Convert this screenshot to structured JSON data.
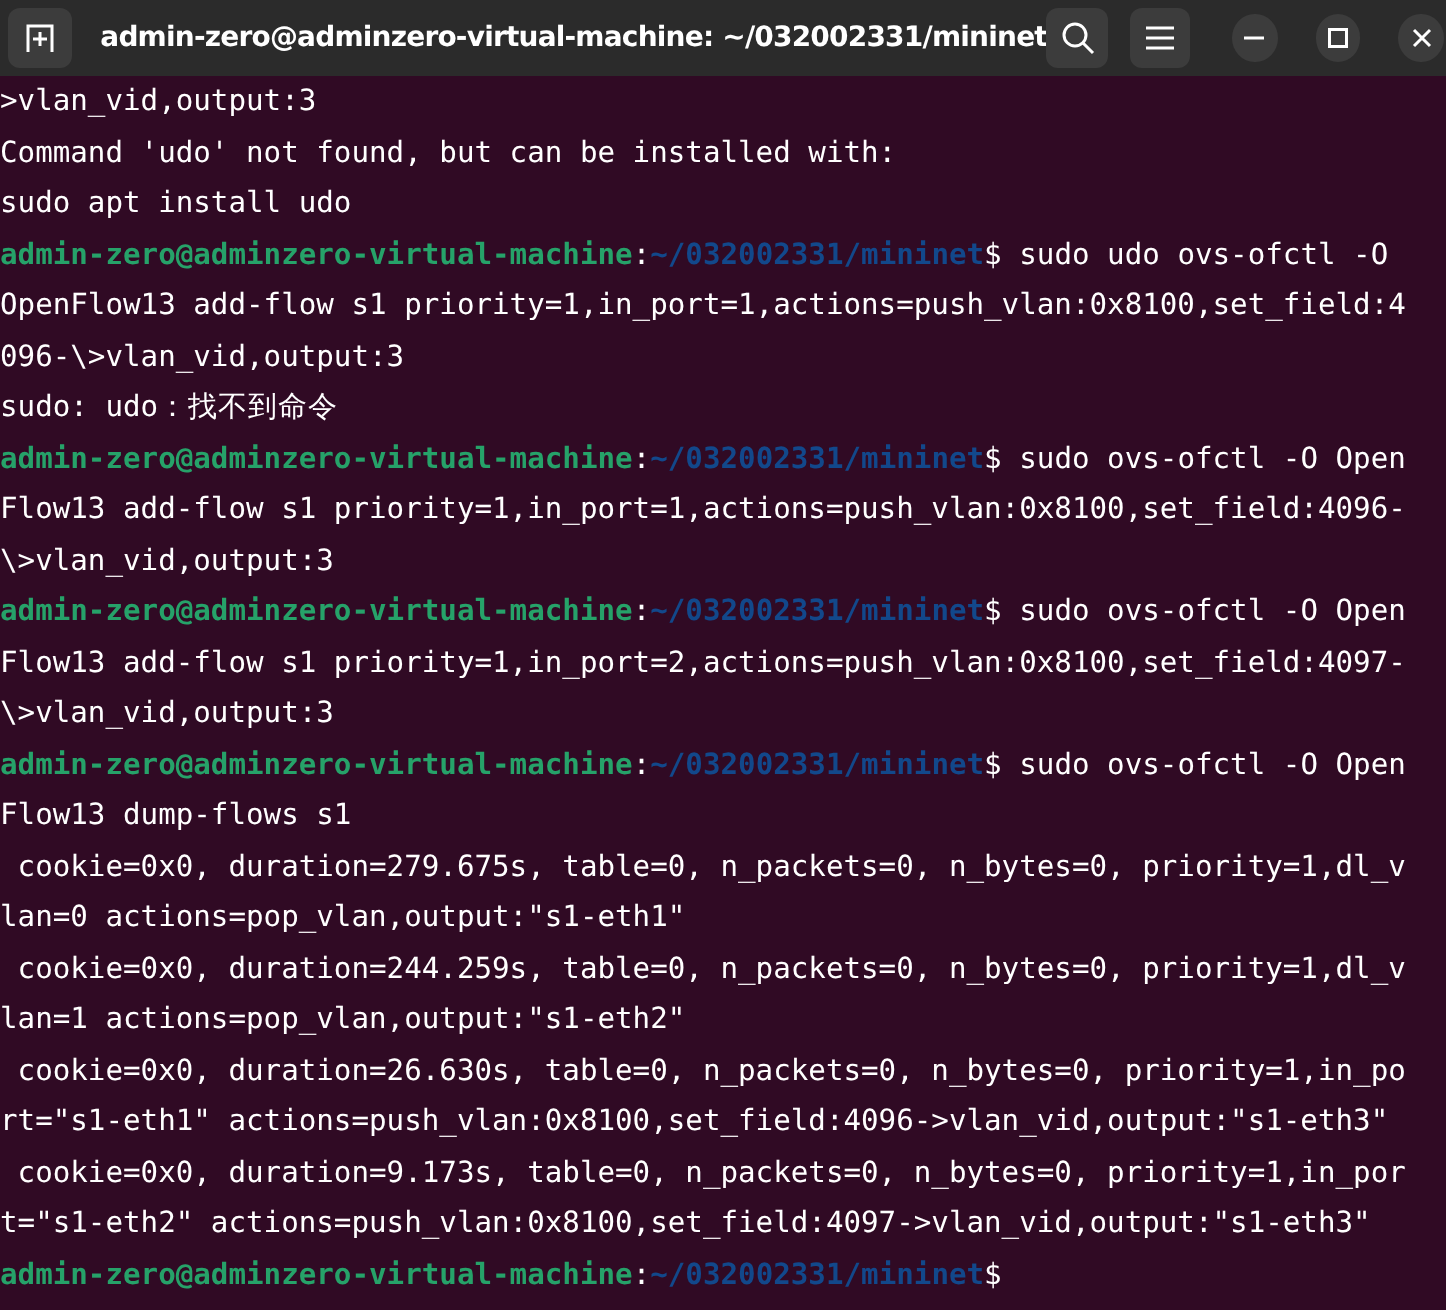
{
  "window": {
    "title": "admin-zero@adminzero-virtual-machine: ~/032002331/mininet"
  },
  "lines": [
    {
      "kind": "output",
      "text": ">vlan_vid,output:3"
    },
    {
      "kind": "output",
      "text": "Command 'udo' not found, but can be installed with:"
    },
    {
      "kind": "output",
      "text": "sudo apt install udo"
    },
    {
      "kind": "prompt",
      "user": "admin-zero@adminzero-virtual-machine",
      "colon": ":",
      "path": "~/032002331/mininet",
      "command": "$ sudo udo ovs-ofctl -O"
    },
    {
      "kind": "output",
      "text": "OpenFlow13 add-flow s1 priority=1,in_port=1,actions=push_vlan:0x8100,set_field:4"
    },
    {
      "kind": "output",
      "text": "096-\\>vlan_vid,output:3"
    },
    {
      "kind": "output",
      "text": "sudo: udo：找不到命令"
    },
    {
      "kind": "prompt",
      "user": "admin-zero@adminzero-virtual-machine",
      "colon": ":",
      "path": "~/032002331/mininet",
      "command": "$ sudo ovs-ofctl -O Open"
    },
    {
      "kind": "output",
      "text": "Flow13 add-flow s1 priority=1,in_port=1,actions=push_vlan:0x8100,set_field:4096-"
    },
    {
      "kind": "output",
      "text": "\\>vlan_vid,output:3"
    },
    {
      "kind": "prompt",
      "user": "admin-zero@adminzero-virtual-machine",
      "colon": ":",
      "path": "~/032002331/mininet",
      "command": "$ sudo ovs-ofctl -O Open"
    },
    {
      "kind": "output",
      "text": "Flow13 add-flow s1 priority=1,in_port=2,actions=push_vlan:0x8100,set_field:4097-"
    },
    {
      "kind": "output",
      "text": "\\>vlan_vid,output:3"
    },
    {
      "kind": "prompt",
      "user": "admin-zero@adminzero-virtual-machine",
      "colon": ":",
      "path": "~/032002331/mininet",
      "command": "$ sudo ovs-ofctl -O Open"
    },
    {
      "kind": "output",
      "text": "Flow13 dump-flows s1"
    },
    {
      "kind": "output",
      "text": " cookie=0x0, duration=279.675s, table=0, n_packets=0, n_bytes=0, priority=1,dl_v"
    },
    {
      "kind": "output",
      "text": "lan=0 actions=pop_vlan,output:\"s1-eth1\""
    },
    {
      "kind": "output",
      "text": " cookie=0x0, duration=244.259s, table=0, n_packets=0, n_bytes=0, priority=1,dl_v"
    },
    {
      "kind": "output",
      "text": "lan=1 actions=pop_vlan,output:\"s1-eth2\""
    },
    {
      "kind": "output",
      "text": " cookie=0x0, duration=26.630s, table=0, n_packets=0, n_bytes=0, priority=1,in_po"
    },
    {
      "kind": "output",
      "text": "rt=\"s1-eth1\" actions=push_vlan:0x8100,set_field:4096->vlan_vid,output:\"s1-eth3\""
    },
    {
      "kind": "output",
      "text": " cookie=0x0, duration=9.173s, table=0, n_packets=0, n_bytes=0, priority=1,in_por"
    },
    {
      "kind": "output",
      "text": "t=\"s1-eth2\" actions=push_vlan:0x8100,set_field:4097->vlan_vid,output:\"s1-eth3\""
    },
    {
      "kind": "prompt",
      "user": "admin-zero@adminzero-virtual-machine",
      "colon": ":",
      "path": "~/032002331/mininet",
      "command": "$"
    }
  ]
}
